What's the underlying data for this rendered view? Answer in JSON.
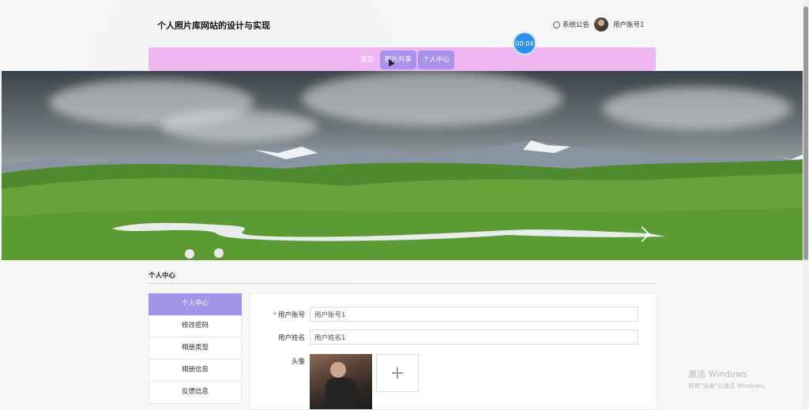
{
  "header": {
    "site_title": "个人照片库网站的设计与实现",
    "notice_label": "系统公告",
    "user_label": "用户账号1",
    "timer": "00:04"
  },
  "nav": {
    "items": [
      {
        "label": "首页"
      },
      {
        "label": "照片共享"
      },
      {
        "label": "个人中心"
      }
    ]
  },
  "section": {
    "title": "个人中心"
  },
  "sidebar": {
    "items": [
      {
        "label": "个人中心"
      },
      {
        "label": "修改密码"
      },
      {
        "label": "相册类型"
      },
      {
        "label": "相册信息"
      },
      {
        "label": "反馈信息"
      }
    ]
  },
  "form": {
    "account_label": "用户账号",
    "account_value": "用户账号1",
    "name_label": "用户姓名",
    "name_value": "用户姓名1",
    "avatar_label": "头像"
  },
  "watermark": {
    "line1": "激活 Windows",
    "line2": "转到\"设置\"以激活 Windows。"
  },
  "colors": {
    "nav_bg": "#f0b6f2",
    "accent": "#a095e8",
    "timer": "#2e8ee8"
  }
}
